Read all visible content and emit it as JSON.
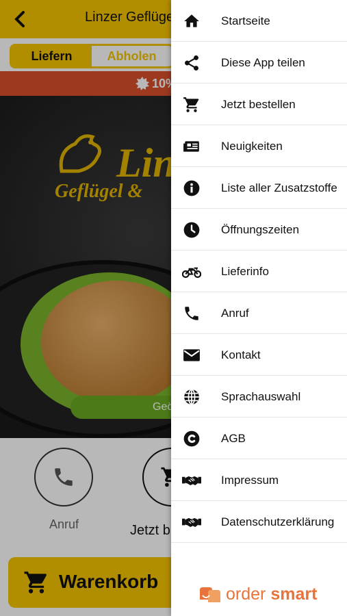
{
  "app": {
    "title": "Linzer Geflügel",
    "tabs": [
      "Liefern",
      "Abholen"
    ],
    "promo": "10%",
    "hero": {
      "logo_word": "Lin",
      "logo_sub": "Geflügel &",
      "pill_text": "Geö"
    },
    "actions": [
      {
        "label": "Anruf",
        "icon": "phone-icon"
      },
      {
        "label": "Jetzt b",
        "icon": "cart-icon"
      }
    ],
    "cart_button": "Warenkorb"
  },
  "drawer": {
    "items": [
      {
        "label": "Startseite",
        "icon": "home-icon"
      },
      {
        "label": "Diese App teilen",
        "icon": "share-icon"
      },
      {
        "label": "Jetzt bestellen",
        "icon": "cart-icon"
      },
      {
        "label": "Neuigkeiten",
        "icon": "news-icon"
      },
      {
        "label": "Liste aller Zusatzstoffe",
        "icon": "info-icon"
      },
      {
        "label": "Öffnungszeiten",
        "icon": "clock-icon"
      },
      {
        "label": "Lieferinfo",
        "icon": "motorbike-icon"
      },
      {
        "label": "Anruf",
        "icon": "phone-icon"
      },
      {
        "label": "Kontakt",
        "icon": "mail-icon"
      },
      {
        "label": "Sprachauswahl",
        "icon": "globe-icon"
      },
      {
        "label": "AGB",
        "icon": "copyright-icon"
      },
      {
        "label": "Impressum",
        "icon": "handshake-icon"
      },
      {
        "label": "Datenschutzerklärung",
        "icon": "handshake-icon"
      }
    ],
    "brand": {
      "part1": "order ",
      "part2": "smart"
    }
  },
  "colors": {
    "accent": "#f5c400",
    "promo": "#d9502c",
    "brand": "#e8743b",
    "pill": "#6aaa22"
  }
}
